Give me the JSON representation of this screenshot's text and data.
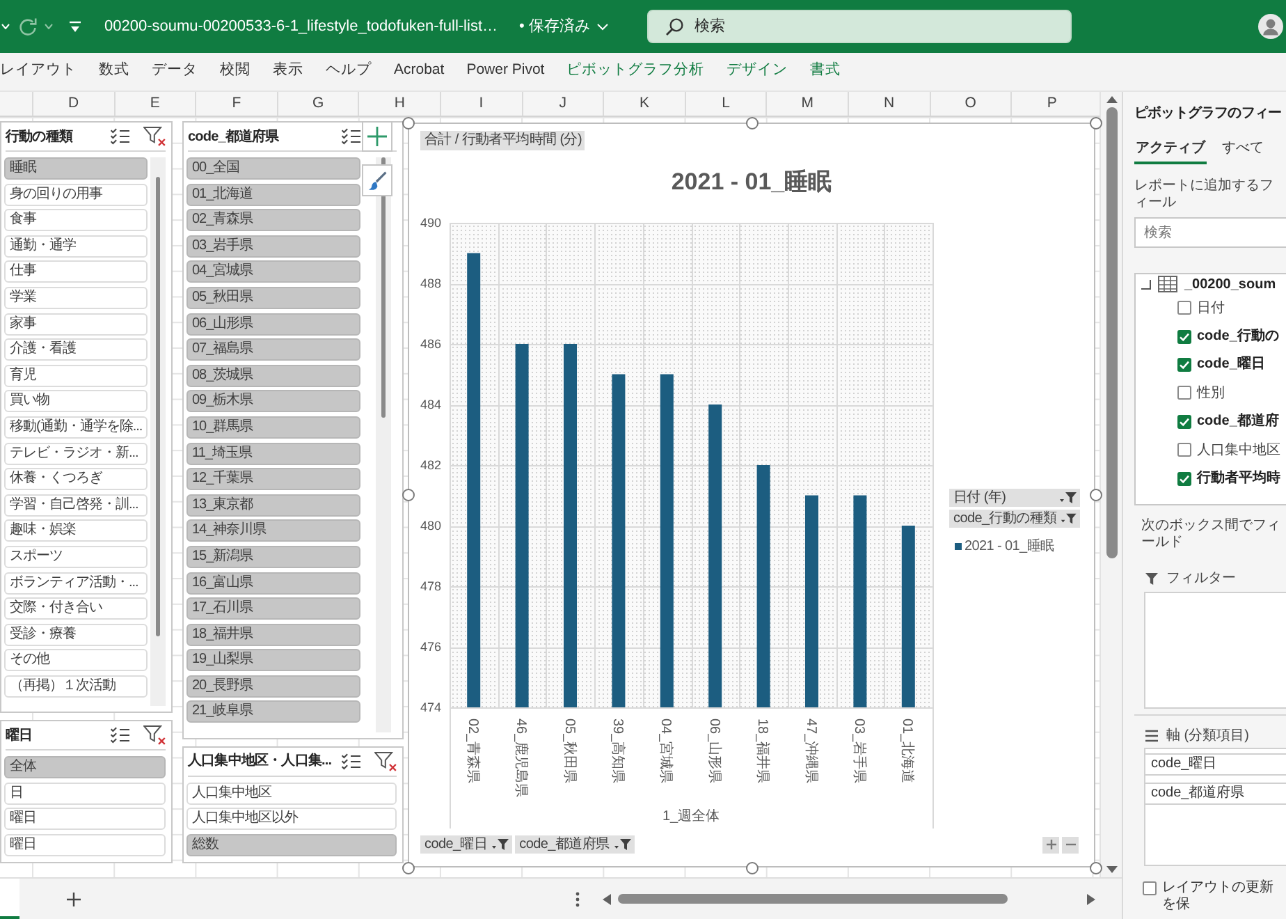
{
  "title_bar": {
    "file_name": "00200-soumu-00200533-6-1_lifestyle_todofuken-full-list…",
    "save_status": "• 保存済み",
    "search_placeholder": "検索"
  },
  "ribbon_tabs": [
    {
      "label": "レイアウト",
      "contextual": false,
      "selected": false
    },
    {
      "label": "数式",
      "contextual": false,
      "selected": false
    },
    {
      "label": "データ",
      "contextual": false,
      "selected": false
    },
    {
      "label": "校閲",
      "contextual": false,
      "selected": false
    },
    {
      "label": "表示",
      "contextual": false,
      "selected": false
    },
    {
      "label": "ヘルプ",
      "contextual": false,
      "selected": false
    },
    {
      "label": "Acrobat",
      "contextual": false,
      "selected": false
    },
    {
      "label": "Power Pivot",
      "contextual": false,
      "selected": false
    },
    {
      "label": "ピボットグラフ分析",
      "contextual": true,
      "selected": false
    },
    {
      "label": "デザイン",
      "contextual": true,
      "selected": false
    },
    {
      "label": "書式",
      "contextual": true,
      "selected": false
    }
  ],
  "column_headers": [
    "D",
    "E",
    "F",
    "G",
    "H",
    "I",
    "J",
    "K",
    "L",
    "M",
    "N",
    "O",
    "P"
  ],
  "slicer_columns": [
    {
      "slicers": [
        {
          "title": "行動の種類",
          "clear_filter_icon": true,
          "scrollbar": true,
          "items": [
            {
              "label": "睡眠",
              "selected": true
            },
            {
              "label": "身の回りの用事",
              "selected": false
            },
            {
              "label": "食事",
              "selected": false
            },
            {
              "label": "通勤・通学",
              "selected": false
            },
            {
              "label": "仕事",
              "selected": false
            },
            {
              "label": "学業",
              "selected": false
            },
            {
              "label": "家事",
              "selected": false
            },
            {
              "label": "介護・看護",
              "selected": false
            },
            {
              "label": "育児",
              "selected": false
            },
            {
              "label": "買い物",
              "selected": false
            },
            {
              "label": "移動(通勤・通学を除...",
              "selected": false
            },
            {
              "label": "テレビ・ラジオ・新...",
              "selected": false
            },
            {
              "label": "休養・くつろぎ",
              "selected": false
            },
            {
              "label": "学習・自己啓発・訓...",
              "selected": false
            },
            {
              "label": "趣味・娯楽",
              "selected": false
            },
            {
              "label": "スポーツ",
              "selected": false
            },
            {
              "label": "ボランティア活動・...",
              "selected": false
            },
            {
              "label": "交際・付き合い",
              "selected": false
            },
            {
              "label": "受診・療養",
              "selected": false
            },
            {
              "label": "その他",
              "selected": false
            },
            {
              "label": "（再掲）１次活動",
              "selected": false
            }
          ]
        },
        {
          "title": "曜日",
          "clear_filter_icon": true,
          "scrollbar": false,
          "items": [
            {
              "label": "全体",
              "selected": true
            },
            {
              "label": "日",
              "selected": false
            },
            {
              "label": "曜日",
              "selected": false
            },
            {
              "label": "曜日",
              "selected": false
            }
          ]
        }
      ]
    },
    {
      "slicers": [
        {
          "title": "code_都道府県",
          "clear_filter_icon": false,
          "scrollbar": true,
          "items": [
            {
              "label": "00_全国",
              "selected": true
            },
            {
              "label": "01_北海道",
              "selected": true
            },
            {
              "label": "02_青森県",
              "selected": true
            },
            {
              "label": "03_岩手県",
              "selected": true
            },
            {
              "label": "04_宮城県",
              "selected": true
            },
            {
              "label": "05_秋田県",
              "selected": true
            },
            {
              "label": "06_山形県",
              "selected": true
            },
            {
              "label": "07_福島県",
              "selected": true
            },
            {
              "label": "08_茨城県",
              "selected": true
            },
            {
              "label": "09_栃木県",
              "selected": true
            },
            {
              "label": "10_群馬県",
              "selected": true
            },
            {
              "label": "11_埼玉県",
              "selected": true
            },
            {
              "label": "12_千葉県",
              "selected": true
            },
            {
              "label": "13_東京都",
              "selected": true
            },
            {
              "label": "14_神奈川県",
              "selected": true
            },
            {
              "label": "15_新潟県",
              "selected": true
            },
            {
              "label": "16_富山県",
              "selected": true
            },
            {
              "label": "17_石川県",
              "selected": true
            },
            {
              "label": "18_福井県",
              "selected": true
            },
            {
              "label": "19_山梨県",
              "selected": true
            },
            {
              "label": "20_長野県",
              "selected": true
            },
            {
              "label": "21_岐阜県",
              "selected": true
            }
          ]
        },
        {
          "title": "人口集中地区・人口集...",
          "clear_filter_icon": true,
          "scrollbar": false,
          "items": [
            {
              "label": "人口集中地区",
              "selected": false
            },
            {
              "label": "人口集中地区以外",
              "selected": false
            },
            {
              "label": "総数",
              "selected": true
            }
          ]
        }
      ]
    }
  ],
  "pivot_chart": {
    "value_field_button": "合計 / 行動者平均時間 (分)",
    "legend_field_buttons": [
      "日付 (年)",
      "code_行動の種類"
    ],
    "axis_field_buttons": [
      "code_曜日",
      "code_都道府県"
    ],
    "chart_data": {
      "type": "bar",
      "title": "2021 - 01_睡眠",
      "xlabel": "1_週全体",
      "categories": [
        "02_青森県",
        "46_鹿児島県",
        "05_秋田県",
        "39_高知県",
        "04_宮城県",
        "06_山形県",
        "18_福井県",
        "47_沖縄県",
        "03_岩手県",
        "01_北海道"
      ],
      "series": [
        {
          "name": "2021 - 01_睡眠",
          "color": "#1c5d80",
          "values": [
            489,
            486,
            486,
            485,
            485,
            484,
            482,
            481,
            481,
            480
          ]
        }
      ],
      "ylim": [
        474,
        490
      ],
      "yticks": [
        474,
        476,
        478,
        480,
        482,
        484,
        486,
        488,
        490
      ],
      "grid": true
    }
  },
  "field_pane": {
    "title": "ピボットグラフのフィー",
    "tabs": [
      {
        "label": "アクティブ",
        "selected": true
      },
      {
        "label": "すべて",
        "selected": false
      }
    ],
    "instruction": "レポートに追加するフィール",
    "search_placeholder": "検索",
    "table": {
      "name": "_00200_soum",
      "expanded": true
    },
    "fields": [
      {
        "label": "日付",
        "checked": false
      },
      {
        "label": "code_行動の",
        "checked": true
      },
      {
        "label": "code_曜日",
        "checked": true
      },
      {
        "label": "性別",
        "checked": false
      },
      {
        "label": "code_都道府",
        "checked": true
      },
      {
        "label": "人口集中地区",
        "checked": false
      },
      {
        "label": "行動者平均時",
        "checked": true
      }
    ],
    "drag_hint": "次のボックス間でフィールド",
    "areas": [
      {
        "kind": "filter",
        "title": "フィルター"
      },
      {
        "kind": "axis",
        "title": "軸 (分類項目)",
        "items": [
          "code_曜日",
          "code_都道府県"
        ]
      }
    ],
    "defer_update": {
      "label": "レイアウトの更新を保",
      "checked": false
    }
  }
}
